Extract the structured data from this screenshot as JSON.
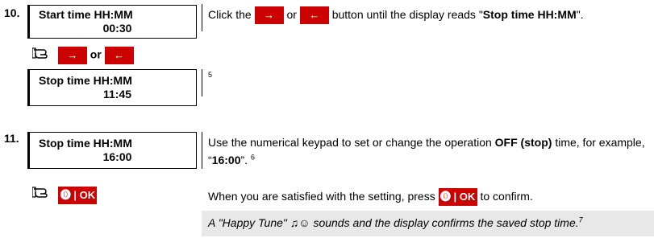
{
  "steps": [
    {
      "number": "10.",
      "display": {
        "line1": "Start time HH:MM",
        "line2": "00:30"
      },
      "instruction": {
        "pre": "Click the ",
        "or": " or ",
        "post": " button until the display reads \"",
        "bold": "Stop time HH:MM",
        "end": "\"."
      },
      "action": {
        "or": "or"
      },
      "result_display": {
        "line1": "Stop time HH:MM",
        "line2": "11:45"
      },
      "footnote": "5"
    },
    {
      "number": "11.",
      "display": {
        "line1": "Stop time HH:MM",
        "line2": "16:00"
      },
      "instruction": {
        "pre": "Use the numerical keypad to set or change the operation ",
        "bold": "OFF (stop)",
        "mid": " time, for example, “",
        "bold2": "16:00",
        "end": "”.",
        "footnote": "6"
      },
      "confirm": {
        "pre": "When you are satisfied with the setting, press ",
        "post": " to confirm."
      },
      "note": {
        "text": "A \"Happy Tune\" ♫☺ sounds and the display confirms the saved stop time.",
        "footnote": "7"
      }
    }
  ],
  "buttons": {
    "right": "→",
    "left": "←",
    "ok": "⓿ | OK"
  }
}
